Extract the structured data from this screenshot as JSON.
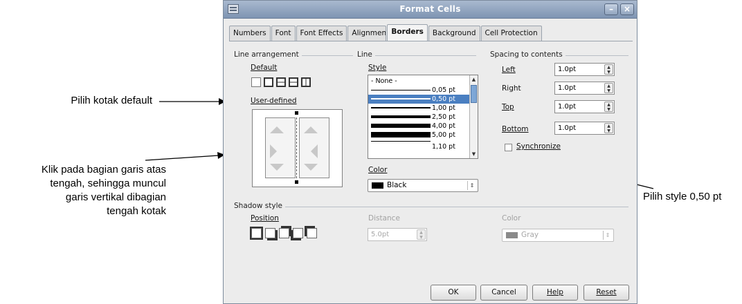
{
  "annotations": {
    "default_note": "Pilih kotak default",
    "click_note_lines": [
      "Klik pada bagian garis atas",
      "tengah, sehingga muncul",
      "garis vertikal dibagian",
      "tengah kotak"
    ],
    "style_note": "Pilih style 0,50 pt"
  },
  "dialog": {
    "title": "Format Cells",
    "tabs": [
      "Numbers",
      "Font",
      "Font Effects",
      "Alignment",
      "Borders",
      "Background",
      "Cell Protection"
    ],
    "active_tab": "Borders"
  },
  "line_arrangement": {
    "title": "Line arrangement",
    "default_label": "Default",
    "user_defined_label": "User-defined"
  },
  "line": {
    "title": "Line",
    "style_label": "Style",
    "styles": [
      {
        "label": "- None -"
      },
      {
        "label": "0,05 pt"
      },
      {
        "label": "0,50 pt",
        "selected": true
      },
      {
        "label": "1,00 pt"
      },
      {
        "label": "2,50 pt"
      },
      {
        "label": "4,00 pt"
      },
      {
        "label": "5,00 pt"
      },
      {
        "label": "1,10 pt"
      }
    ],
    "color_label": "Color",
    "color_value": "Black",
    "color_swatch": "#000000"
  },
  "spacing": {
    "title": "Spacing to contents",
    "left_label": "Left",
    "left_value": "1.0pt",
    "right_label": "Right",
    "right_value": "1.0pt",
    "top_label": "Top",
    "top_value": "1.0pt",
    "bottom_label": "Bottom",
    "bottom_value": "1.0pt",
    "synchronize_label": "Synchronize",
    "synchronize_checked": false
  },
  "shadow": {
    "title": "Shadow style",
    "position_label": "Position",
    "distance_label": "Distance",
    "distance_value": "5.0pt",
    "color_label": "Color",
    "color_value": "Gray",
    "color_swatch": "#808080"
  },
  "buttons": {
    "ok": "OK",
    "cancel": "Cancel",
    "help": "Help",
    "reset": "Reset"
  },
  "colors": {
    "selection": "#4a7fc1",
    "titlebar": "#8fa3be"
  }
}
